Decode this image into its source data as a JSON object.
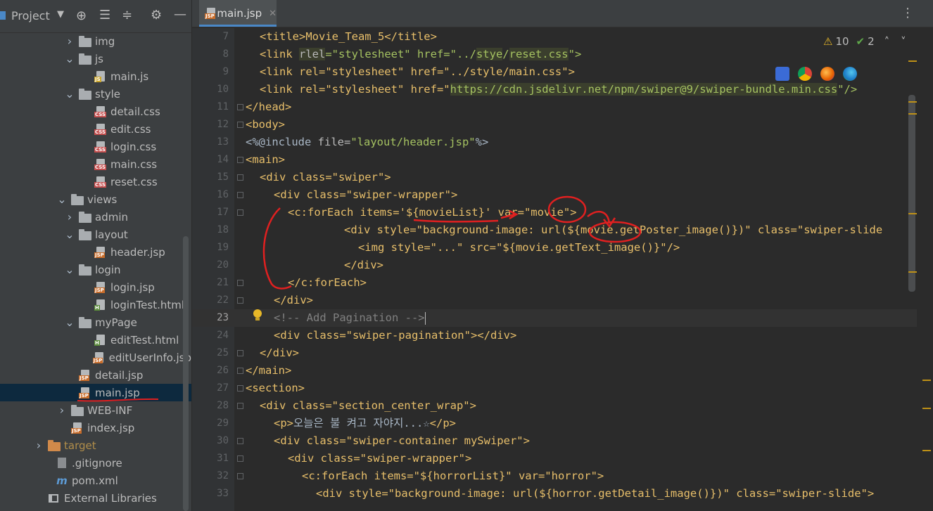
{
  "project_panel": {
    "title": "Project",
    "tree": [
      {
        "label": "img",
        "type": "folder",
        "expanded": false,
        "indent": 1
      },
      {
        "label": "js",
        "type": "folder",
        "expanded": true,
        "indent": 1
      },
      {
        "label": "main.js",
        "type": "js",
        "indent": 2
      },
      {
        "label": "style",
        "type": "folder",
        "expanded": true,
        "indent": 1
      },
      {
        "label": "detail.css",
        "type": "css",
        "indent": 2
      },
      {
        "label": "edit.css",
        "type": "css",
        "indent": 2
      },
      {
        "label": "login.css",
        "type": "css",
        "indent": 2
      },
      {
        "label": "main.css",
        "type": "css",
        "indent": 2
      },
      {
        "label": "reset.css",
        "type": "css",
        "indent": 2
      },
      {
        "label": "views",
        "type": "folder",
        "expanded": true,
        "indent": 0.5
      },
      {
        "label": "admin",
        "type": "folder",
        "expanded": false,
        "indent": 1
      },
      {
        "label": "layout",
        "type": "folder",
        "expanded": true,
        "indent": 1
      },
      {
        "label": "header.jsp",
        "type": "jsp",
        "indent": 2
      },
      {
        "label": "login",
        "type": "folder",
        "expanded": true,
        "indent": 1
      },
      {
        "label": "login.jsp",
        "type": "jsp",
        "indent": 2
      },
      {
        "label": "loginTest.html",
        "type": "html",
        "indent": 2
      },
      {
        "label": "myPage",
        "type": "folder",
        "expanded": true,
        "indent": 1
      },
      {
        "label": "editTest.html",
        "type": "html",
        "indent": 2
      },
      {
        "label": "editUserInfo.jsp",
        "type": "jsp",
        "indent": 2
      },
      {
        "label": "detail.jsp",
        "type": "jsp",
        "indent": 1
      },
      {
        "label": "main.jsp",
        "type": "jsp",
        "indent": 1,
        "selected": true
      },
      {
        "label": "WEB-INF",
        "type": "folder",
        "expanded": false,
        "indent": 0.5
      },
      {
        "label": "index.jsp",
        "type": "jsp",
        "indent": 0.5
      },
      {
        "label": "target",
        "type": "folder-orange",
        "expanded": false,
        "indent": -1
      },
      {
        "label": ".gitignore",
        "type": "git",
        "indent": -0.5
      },
      {
        "label": "pom.xml",
        "type": "maven",
        "indent": -0.5
      },
      {
        "label": "External Libraries",
        "type": "lib",
        "indent": -1
      }
    ]
  },
  "editor": {
    "tab": "main.jsp",
    "warnings": "10",
    "checks": "2",
    "current_line": "23",
    "line_numbers": [
      "7",
      "8",
      "9",
      "10",
      "11",
      "12",
      "13",
      "14",
      "15",
      "16",
      "17",
      "18",
      "19",
      "20",
      "21",
      "22",
      "23",
      "24",
      "25",
      "26",
      "27",
      "28",
      "29",
      "30",
      "31",
      "32",
      "33"
    ],
    "lines": {
      "l7": "<title>Movie_Team_5</title>",
      "l8a": "<link ",
      "l8b": "rlel",
      "l8c": "=\"stylesheet\" href=\"../",
      "l8d": "stye",
      "l8e": "/",
      "l8f": "reset.css",
      "l8g": "\">",
      "l9": "<link rel=\"stylesheet\" href=\"../style/main.css\">",
      "l10a": "<link rel=\"stylesheet\" href=\"",
      "l10b": "https://cdn.jsdelivr.net/npm/swiper@9/swiper-bundle.min.css",
      "l10c": "\"/>",
      "l11": "</head>",
      "l12": "<body>",
      "l13a": "<%@include ",
      "l13b": "file=",
      "l13c": "\"layout/header.jsp\"",
      "l13d": "%>",
      "l14": "<main>",
      "l15": "<div class=\"swiper\">",
      "l16": "<div class=\"swiper-wrapper\">",
      "l17": "<c:forEach items='${movieList}' var=\"movie\">",
      "l18": "<div style=\"background-image: url(${movie.getPoster_image()})\" class=\"swiper-slide",
      "l19": "<img style=\"...\" src=\"${movie.getText_image()}\"/>",
      "l20": "</div>",
      "l21": "</c:forEach>",
      "l22": "</div>",
      "l23": "<!-- Add Pagination -->",
      "l24": "<div class=\"swiper-pagination\"></div>",
      "l25": "</div>",
      "l26": "</main>",
      "l27": "<section>",
      "l28": "<div class=\"section_center_wrap\">",
      "l29a": "<p>",
      "l29b": "오늘은 불 켜고 자야지...☆",
      "l29c": "</p>",
      "l30": "<div class=\"swiper-container mySwiper\">",
      "l31": "<div class=\"swiper-wrapper\">",
      "l32": "<c:forEach items=\"${horrorList}\" var=\"horror\">",
      "l33": "<div style=\"background-image: url(${horror.getDetail_image()})\" class=\"swiper-slide\">"
    }
  },
  "colors": {
    "bg": "#2b2b2b",
    "tag": "#e8bf6a",
    "attr": "#bababa",
    "value": "#a5c261",
    "comment": "#808080",
    "annotation": "#e02020"
  },
  "icons": [
    "target-icon",
    "collapse-all-icon",
    "expand-all-icon",
    "gear-icon",
    "minimize-icon",
    "more-icon",
    "warning-icon",
    "check-icon",
    "chevron-up-icon",
    "chevron-down-icon",
    "lightbulb-icon"
  ]
}
